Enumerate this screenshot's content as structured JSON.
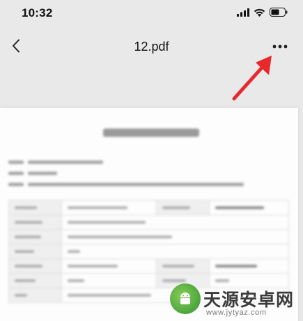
{
  "status_bar": {
    "time": "10:32",
    "icons": [
      "signal-icon",
      "wifi-icon",
      "battery-icon"
    ]
  },
  "nav": {
    "title": "12.pdf",
    "back_icon": "chevron-left-icon",
    "more_icon": "more-horizontal-icon"
  },
  "annotation": {
    "arrow_color": "#e8282b"
  },
  "document": {
    "table_rows": 7
  },
  "watermark": {
    "title": "天源安卓网",
    "url": "www.jytyaz.com"
  },
  "colors": {
    "background": "#e9e9e9",
    "page": "#fdfdfd",
    "accent_arrow": "#e8282b"
  }
}
